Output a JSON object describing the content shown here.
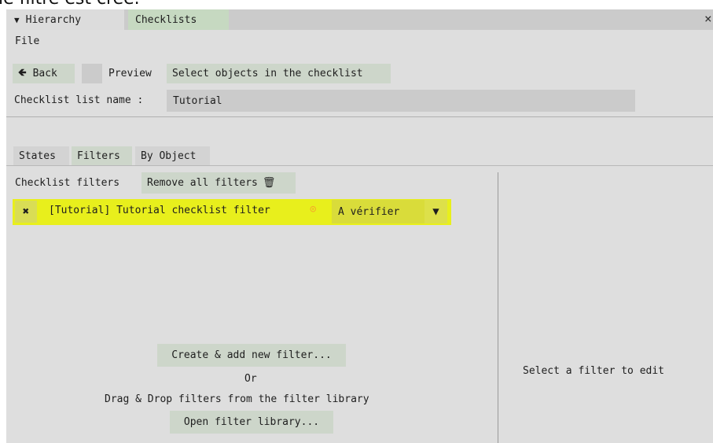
{
  "caption_fragment": "le filtre est créé.",
  "tabs": {
    "hierarchy": {
      "icon": "▼",
      "label": "Hierarchy"
    },
    "checklists": {
      "label": "Checklists"
    },
    "close": "×"
  },
  "menu": {
    "file": "File"
  },
  "toolbar": {
    "back_icon": "🡸",
    "back_label": "Back",
    "preview_label": "Preview",
    "select_objects_label": "Select objects in the checklist"
  },
  "checklist_name": {
    "label": "Checklist list name :",
    "value": "Tutorial"
  },
  "subtabs": [
    "States",
    "Filters",
    "By Object"
  ],
  "filters": {
    "header_label": "Checklist filters",
    "remove_all_label": "Remove all filters",
    "trash_icon": "🗑",
    "items": [
      {
        "remove_icon": "✖",
        "name": "[Tutorial] Tutorial  checklist filter",
        "status_icon": "⊙",
        "state_value": "A vérifier",
        "dropdown_icon": "▼"
      }
    ],
    "create_label": "Create & add new filter...",
    "or_text": "Or",
    "drag_text": "Drag & Drop filters from the filter library",
    "open_library_label": "Open filter library..."
  },
  "edit_panel": {
    "placeholder": "Select a filter to edit"
  },
  "colors": {
    "highlight": "#e8ef1c",
    "status": "#f4a82a",
    "accent_button": "#cdd6ca"
  }
}
